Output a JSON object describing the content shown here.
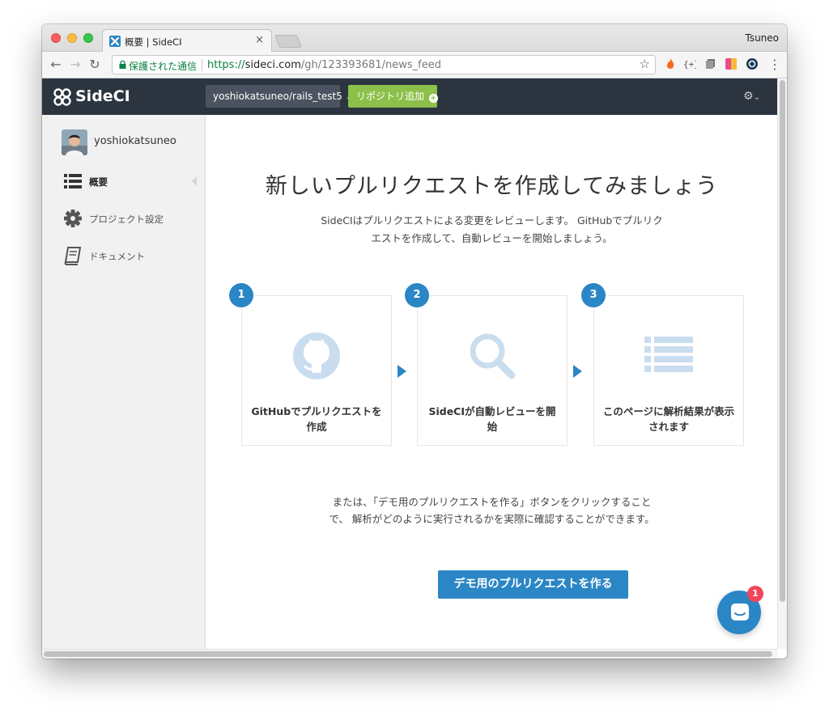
{
  "browser": {
    "tab_title": "概要 | SideCI",
    "tab_close": "×",
    "profile_name": "Tsuneo",
    "secure_label": "保護された通信",
    "url_scheme": "https://",
    "url_host": "sideci.com",
    "url_path": "/gh/123393681/news_feed",
    "star": "☆"
  },
  "header": {
    "logo_text": "SideCI",
    "repo_name": "yoshiokatsuneo/rails_test5",
    "add_repo_label": "リポジトリ追加",
    "gear_caret": "⌄"
  },
  "sidebar": {
    "username": "yoshiokatsuneo",
    "items": [
      {
        "label": "概要",
        "icon": "list-icon"
      },
      {
        "label": "プロジェクト設定",
        "icon": "gear-icon"
      },
      {
        "label": "ドキュメント",
        "icon": "book-icon"
      }
    ]
  },
  "main": {
    "headline": "新しいプルリクエストを作成してみましょう",
    "intro": "SideCIはプルリクエストによる変更をレビューします。 GitHubでプルリクエストを作成して、自動レビューを開始しましょう。",
    "steps": [
      {
        "number": "1",
        "label": "GitHubでプルリクエストを作成",
        "icon": "github-icon"
      },
      {
        "number": "2",
        "label": "SideCIが自動レビューを開始",
        "icon": "magnifier-icon"
      },
      {
        "number": "3",
        "label": "このページに解析結果が表示されます",
        "icon": "list-icon"
      }
    ],
    "demo_note": "または、「デモ用のプルリクエストを作る」ボタンをクリックすることで、 解析がどのように実行されるかを実際に確認することができます。",
    "demo_button": "デモ用のプルリクエストを作る"
  },
  "chat": {
    "badge_count": "1"
  },
  "colors": {
    "header_bg": "#2c3440",
    "accent_blue": "#2b86c5",
    "add_green": "#8cc04a",
    "badge_red": "#f0455b",
    "secure_green": "#0b8043"
  }
}
